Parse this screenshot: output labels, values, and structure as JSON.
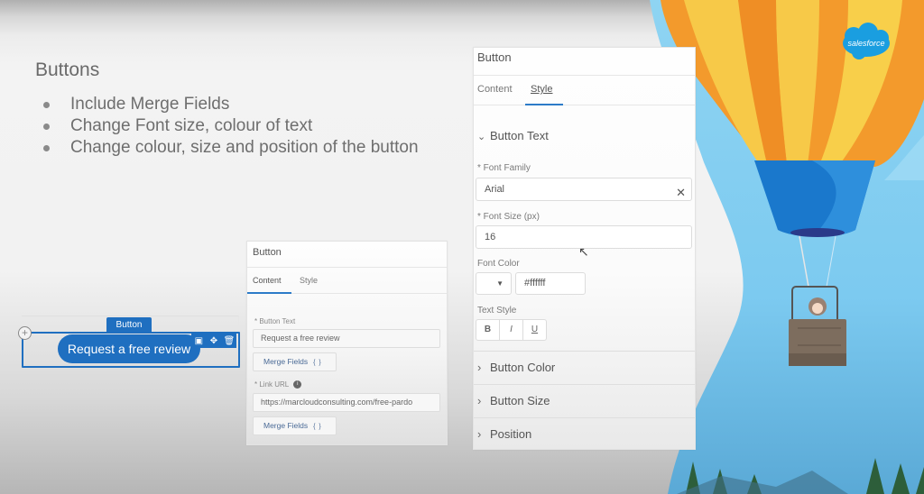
{
  "slide": {
    "title": "Buttons",
    "bullets": [
      "Include Merge Fields",
      "Change Font size, colour of text",
      "Change colour, size and position of the button"
    ]
  },
  "brand": {
    "logo_text": "salesforce",
    "colors": {
      "accent_blue": "#1f6fc0",
      "tab_underline": "#2c7bc8",
      "balloon_yellow": "#f7c948",
      "balloon_orange": "#f39a2c",
      "sky_blue": "#7fcdf0",
      "basket_blue": "#1a78cc"
    }
  },
  "style_panel": {
    "title": "Button",
    "tabs": [
      {
        "label": "Content",
        "active": false
      },
      {
        "label": "Style",
        "active": true
      }
    ],
    "section_open": {
      "label": "Button Text",
      "icon": "chevron-down-icon"
    },
    "font_family": {
      "label": "* Font Family",
      "value": "Arial",
      "clear_icon": "close-icon"
    },
    "font_size": {
      "label": "* Font Size (px)",
      "value": "16"
    },
    "font_color": {
      "label": "Font Color",
      "swatch_value": "",
      "dropdown_icon": "caret-down-icon",
      "hex_value": "#ffffff"
    },
    "text_style": {
      "label": "Text Style",
      "buttons": [
        "B",
        "I",
        "U"
      ]
    },
    "collapsed_sections": [
      {
        "label": "Button Color",
        "icon": "chevron-right-icon"
      },
      {
        "label": "Button Size",
        "icon": "chevron-right-icon"
      },
      {
        "label": "Position",
        "icon": "chevron-right-icon"
      }
    ]
  },
  "content_panel": {
    "title": "Button",
    "tabs": [
      {
        "label": "Content",
        "active": true
      },
      {
        "label": "Style",
        "active": false
      }
    ],
    "button_text": {
      "label": "* Button Text",
      "value": "Request a free review"
    },
    "merge_fields_label": "Merge Fields",
    "merge_fields_icon": "{ }",
    "link_url": {
      "label": "* Link URL",
      "info_icon": "i",
      "value": "https://marcloudconsulting.com/free-pardo"
    }
  },
  "canvas_preview": {
    "tag_label": "Button",
    "button_label": "Request a free review",
    "add_icon": "+",
    "toolbar_icons": [
      "layout-icon",
      "move-icon",
      "trash-icon"
    ]
  }
}
